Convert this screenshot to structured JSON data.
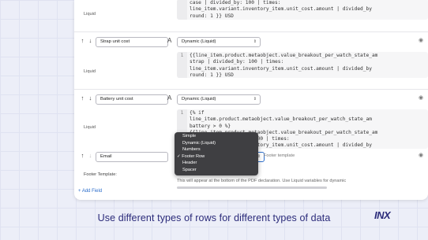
{
  "rows": [
    {
      "name": "",
      "type": "",
      "liquid_label": "Liquid",
      "code_line_number": "",
      "code": "case | divided_by: 100 | times:\nline_item.variant.inventory_item.unit_cost.amount | divided_by\nround: 1 }} USD"
    },
    {
      "name": "Strap unit cost",
      "type": "Dynamic (Liquid)",
      "liquid_label": "Liquid",
      "code_line_number": "1",
      "code": "{{line_item.product.metaobject.value_breakout_per_watch_state_am\nstrap | divided_by: 100 | times:\nline_item.variant.inventory_item.unit_cost.amount | divided_by\nround: 1 }} USD"
    },
    {
      "name": "Battery unit cost",
      "type": "Dynamic (Liquid)",
      "liquid_label": "Liquid",
      "code_line_number": "1",
      "code": "{% if\nline_item.product.metaobject.value_breakout_per_watch_state_am\nbattery > 0 %}\n{{line_item.product.metaobject.value_breakout_per_watch_state_am\nbattery | divided_by: 100 | times:\nline_item.variant.inventory_item.unit_cost.amount | divided_by\nround: 1 }} USD"
    },
    {
      "name": "Email",
      "type": "Footer Row",
      "placeholder": "Footer template"
    }
  ],
  "dropdown": {
    "options": [
      "Simple",
      "Dynamic (Liquid)",
      "Numbers",
      "Footer Row",
      "Header",
      "Spacer"
    ],
    "selected": "Footer Row",
    "checkmark": "✓"
  },
  "footer": {
    "label": "Footer Template:",
    "help": "This will appear at the bottom of the PDF declaration. Use Liquid variables for dynamic"
  },
  "add_field": "+ Add Field",
  "caption": "Use different types of rows for different types of data",
  "logo": "INX",
  "colors": {
    "accent": "#2c6ecb",
    "caption": "#2b2b7a",
    "dropdown_bg": "#3f3f42"
  },
  "icons": {
    "up": "↑",
    "down": "↓",
    "font": "A",
    "eye": "◉",
    "chevron": "⌃⌄"
  }
}
